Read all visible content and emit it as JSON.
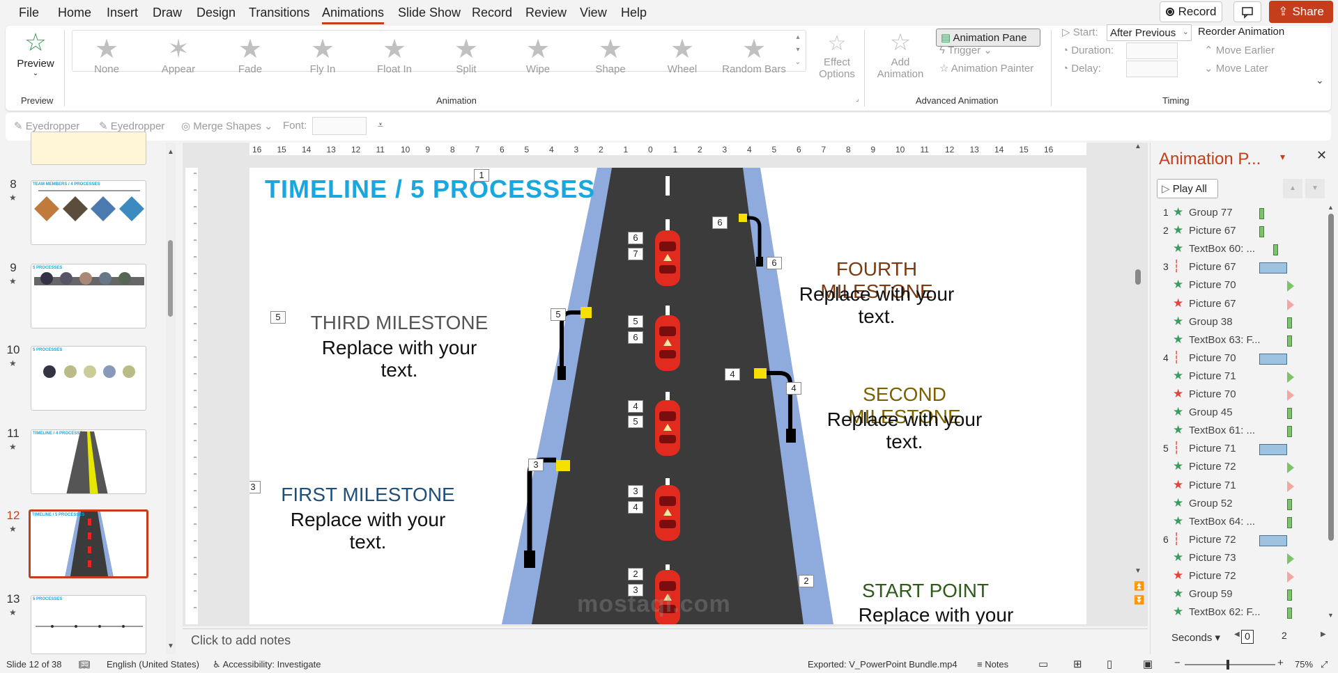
{
  "menu": {
    "items": [
      "File",
      "Home",
      "Insert",
      "Draw",
      "Design",
      "Transitions",
      "Animations",
      "Slide Show",
      "Record",
      "Review",
      "View",
      "Help"
    ],
    "active": "Animations"
  },
  "titlebar": {
    "record": "Record",
    "share": "Share"
  },
  "ribbon": {
    "preview": {
      "label": "Preview",
      "group": "Preview"
    },
    "effects": [
      "None",
      "Appear",
      "Fade",
      "Fly In",
      "Float In",
      "Split",
      "Wipe",
      "Shape",
      "Wheel",
      "Random Bars"
    ],
    "effect_options": [
      "Effect",
      "Options"
    ],
    "animation_group": "Animation",
    "add_animation": [
      "Add",
      "Animation"
    ],
    "animation_pane": "Animation Pane",
    "trigger": "Trigger",
    "animation_painter": "Animation Painter",
    "advanced_group": "Advanced Animation",
    "start_label": "Start:",
    "start_value": "After Previous",
    "duration_label": "Duration:",
    "delay_label": "Delay:",
    "reorder": "Reorder Animation",
    "move_earlier": "Move Earlier",
    "move_later": "Move Later",
    "timing_group": "Timing"
  },
  "toolbar2": {
    "eyedropper1": "Eyedropper",
    "eyedropper2": "Eyedropper",
    "merge": "Merge Shapes",
    "font": "Font:"
  },
  "thumbnails": [
    {
      "num": "8",
      "title": "TEAM MEMBERS / 4 PROCESSES"
    },
    {
      "num": "9",
      "title": "5 PROCESSES"
    },
    {
      "num": "10",
      "title": "5 PROCESSES"
    },
    {
      "num": "11",
      "title": "TIMELINE / 4 PROCESSES"
    },
    {
      "num": "12",
      "title": "TIMELINE / 5 PROCESSES"
    },
    {
      "num": "13",
      "title": "5 PROCESSES"
    }
  ],
  "slide": {
    "title": "TIMELINE / 5 PROCESSES",
    "fourth": {
      "heading": "FOURTH MILESTONE",
      "body": "Replace with your text."
    },
    "third": {
      "heading": "THIRD MILESTONE",
      "body": "Replace with your text."
    },
    "second": {
      "heading": "SECOND MILESTONE",
      "body": "Replace with your text."
    },
    "first": {
      "heading": "FIRST MILESTONE",
      "body": "Replace with your text."
    },
    "start": {
      "heading": "START POINT",
      "body": "Replace with your text."
    },
    "tags": [
      "1",
      "5",
      "3",
      "6",
      "7",
      "6",
      "6",
      "5",
      "5",
      "6",
      "4",
      "4",
      "4",
      "5",
      "3",
      "3",
      "4",
      "2",
      "3",
      "2"
    ],
    "watermark": "mostaql.com",
    "colors": {
      "title": "#1aa7e0",
      "fourth": "#7a3b12",
      "third": "#555555",
      "second": "#7a6200",
      "first": "#1f4e79",
      "start": "#2e5a1c",
      "road": "#3b3b3b",
      "shoulder": "#8faadc"
    }
  },
  "ruler": [
    "16",
    "15",
    "14",
    "13",
    "12",
    "11",
    "10",
    "9",
    "8",
    "7",
    "6",
    "5",
    "4",
    "3",
    "2",
    "1",
    "0",
    "1",
    "2",
    "3",
    "4",
    "5",
    "6",
    "7",
    "8",
    "9",
    "10",
    "11",
    "12",
    "13",
    "14",
    "15",
    "16"
  ],
  "notes": "Click to add notes",
  "pane": {
    "title": "Animation P...",
    "play_all": "Play All",
    "items": [
      {
        "num": "1",
        "name": "Group 77",
        "type": "entrance",
        "bar": "green-small"
      },
      {
        "num": "2",
        "name": "Picture 67",
        "type": "entrance",
        "bar": "green-small"
      },
      {
        "num": "",
        "name": "TextBox 60: ...",
        "type": "entrance",
        "bar": "green-small"
      },
      {
        "num": "3",
        "name": "Picture 67",
        "type": "path",
        "bar": "blue"
      },
      {
        "num": "",
        "name": "Picture 70",
        "type": "entrance",
        "bar": "green-tri"
      },
      {
        "num": "",
        "name": "Picture 67",
        "type": "exit",
        "bar": "red-tri"
      },
      {
        "num": "",
        "name": "Group 38",
        "type": "entrance",
        "bar": "green-small"
      },
      {
        "num": "",
        "name": "TextBox 63: F...",
        "type": "entrance",
        "bar": "green-small"
      },
      {
        "num": "4",
        "name": "Picture 70",
        "type": "path",
        "bar": "blue"
      },
      {
        "num": "",
        "name": "Picture 71",
        "type": "entrance",
        "bar": "green-tri"
      },
      {
        "num": "",
        "name": "Picture 70",
        "type": "exit",
        "bar": "red-tri"
      },
      {
        "num": "",
        "name": "Group 45",
        "type": "entrance",
        "bar": "green-small"
      },
      {
        "num": "",
        "name": "TextBox 61: ...",
        "type": "entrance",
        "bar": "green-small"
      },
      {
        "num": "5",
        "name": "Picture 71",
        "type": "path",
        "bar": "blue"
      },
      {
        "num": "",
        "name": "Picture 72",
        "type": "entrance",
        "bar": "green-tri"
      },
      {
        "num": "",
        "name": "Picture 71",
        "type": "exit",
        "bar": "red-tri"
      },
      {
        "num": "",
        "name": "Group 52",
        "type": "entrance",
        "bar": "green-small"
      },
      {
        "num": "",
        "name": "TextBox 64: ...",
        "type": "entrance",
        "bar": "green-small"
      },
      {
        "num": "6",
        "name": "Picture 72",
        "type": "path",
        "bar": "blue"
      },
      {
        "num": "",
        "name": "Picture 73",
        "type": "entrance",
        "bar": "green-tri"
      },
      {
        "num": "",
        "name": "Picture 72",
        "type": "exit",
        "bar": "red-tri"
      },
      {
        "num": "",
        "name": "Group 59",
        "type": "entrance",
        "bar": "green-small"
      },
      {
        "num": "",
        "name": "TextBox 62: F...",
        "type": "entrance",
        "bar": "green-small"
      }
    ],
    "seconds": "Seconds",
    "scale": [
      "0",
      "2"
    ]
  },
  "status": {
    "slide": "Slide 12 of 38",
    "language": "English (United States)",
    "accessibility": "Accessibility: Investigate",
    "exported": "Exported: V_PowerPoint Bundle.mp4",
    "notes": "Notes",
    "zoom": "75%"
  }
}
